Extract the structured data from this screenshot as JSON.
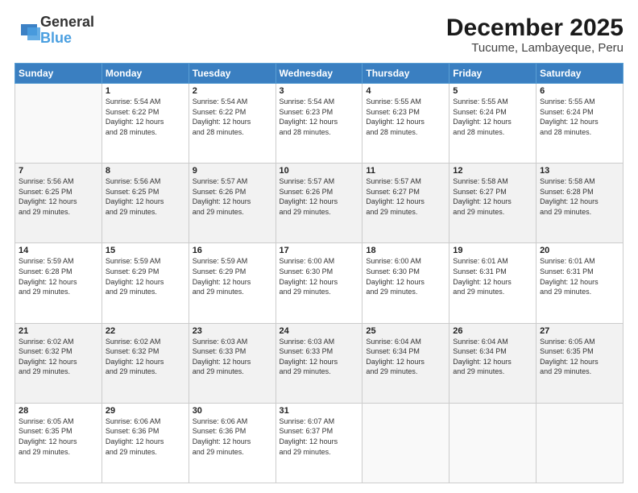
{
  "header": {
    "logo_line1": "General",
    "logo_line2": "Blue",
    "title": "December 2025",
    "subtitle": "Tucume, Lambayeque, Peru"
  },
  "calendar": {
    "days_of_week": [
      "Sunday",
      "Monday",
      "Tuesday",
      "Wednesday",
      "Thursday",
      "Friday",
      "Saturday"
    ],
    "weeks": [
      [
        {
          "num": "",
          "info": ""
        },
        {
          "num": "1",
          "info": "Sunrise: 5:54 AM\nSunset: 6:22 PM\nDaylight: 12 hours\nand 28 minutes."
        },
        {
          "num": "2",
          "info": "Sunrise: 5:54 AM\nSunset: 6:22 PM\nDaylight: 12 hours\nand 28 minutes."
        },
        {
          "num": "3",
          "info": "Sunrise: 5:54 AM\nSunset: 6:23 PM\nDaylight: 12 hours\nand 28 minutes."
        },
        {
          "num": "4",
          "info": "Sunrise: 5:55 AM\nSunset: 6:23 PM\nDaylight: 12 hours\nand 28 minutes."
        },
        {
          "num": "5",
          "info": "Sunrise: 5:55 AM\nSunset: 6:24 PM\nDaylight: 12 hours\nand 28 minutes."
        },
        {
          "num": "6",
          "info": "Sunrise: 5:55 AM\nSunset: 6:24 PM\nDaylight: 12 hours\nand 28 minutes."
        }
      ],
      [
        {
          "num": "7",
          "info": "Sunrise: 5:56 AM\nSunset: 6:25 PM\nDaylight: 12 hours\nand 29 minutes."
        },
        {
          "num": "8",
          "info": "Sunrise: 5:56 AM\nSunset: 6:25 PM\nDaylight: 12 hours\nand 29 minutes."
        },
        {
          "num": "9",
          "info": "Sunrise: 5:57 AM\nSunset: 6:26 PM\nDaylight: 12 hours\nand 29 minutes."
        },
        {
          "num": "10",
          "info": "Sunrise: 5:57 AM\nSunset: 6:26 PM\nDaylight: 12 hours\nand 29 minutes."
        },
        {
          "num": "11",
          "info": "Sunrise: 5:57 AM\nSunset: 6:27 PM\nDaylight: 12 hours\nand 29 minutes."
        },
        {
          "num": "12",
          "info": "Sunrise: 5:58 AM\nSunset: 6:27 PM\nDaylight: 12 hours\nand 29 minutes."
        },
        {
          "num": "13",
          "info": "Sunrise: 5:58 AM\nSunset: 6:28 PM\nDaylight: 12 hours\nand 29 minutes."
        }
      ],
      [
        {
          "num": "14",
          "info": "Sunrise: 5:59 AM\nSunset: 6:28 PM\nDaylight: 12 hours\nand 29 minutes."
        },
        {
          "num": "15",
          "info": "Sunrise: 5:59 AM\nSunset: 6:29 PM\nDaylight: 12 hours\nand 29 minutes."
        },
        {
          "num": "16",
          "info": "Sunrise: 5:59 AM\nSunset: 6:29 PM\nDaylight: 12 hours\nand 29 minutes."
        },
        {
          "num": "17",
          "info": "Sunrise: 6:00 AM\nSunset: 6:30 PM\nDaylight: 12 hours\nand 29 minutes."
        },
        {
          "num": "18",
          "info": "Sunrise: 6:00 AM\nSunset: 6:30 PM\nDaylight: 12 hours\nand 29 minutes."
        },
        {
          "num": "19",
          "info": "Sunrise: 6:01 AM\nSunset: 6:31 PM\nDaylight: 12 hours\nand 29 minutes."
        },
        {
          "num": "20",
          "info": "Sunrise: 6:01 AM\nSunset: 6:31 PM\nDaylight: 12 hours\nand 29 minutes."
        }
      ],
      [
        {
          "num": "21",
          "info": "Sunrise: 6:02 AM\nSunset: 6:32 PM\nDaylight: 12 hours\nand 29 minutes."
        },
        {
          "num": "22",
          "info": "Sunrise: 6:02 AM\nSunset: 6:32 PM\nDaylight: 12 hours\nand 29 minutes."
        },
        {
          "num": "23",
          "info": "Sunrise: 6:03 AM\nSunset: 6:33 PM\nDaylight: 12 hours\nand 29 minutes."
        },
        {
          "num": "24",
          "info": "Sunrise: 6:03 AM\nSunset: 6:33 PM\nDaylight: 12 hours\nand 29 minutes."
        },
        {
          "num": "25",
          "info": "Sunrise: 6:04 AM\nSunset: 6:34 PM\nDaylight: 12 hours\nand 29 minutes."
        },
        {
          "num": "26",
          "info": "Sunrise: 6:04 AM\nSunset: 6:34 PM\nDaylight: 12 hours\nand 29 minutes."
        },
        {
          "num": "27",
          "info": "Sunrise: 6:05 AM\nSunset: 6:35 PM\nDaylight: 12 hours\nand 29 minutes."
        }
      ],
      [
        {
          "num": "28",
          "info": "Sunrise: 6:05 AM\nSunset: 6:35 PM\nDaylight: 12 hours\nand 29 minutes."
        },
        {
          "num": "29",
          "info": "Sunrise: 6:06 AM\nSunset: 6:36 PM\nDaylight: 12 hours\nand 29 minutes."
        },
        {
          "num": "30",
          "info": "Sunrise: 6:06 AM\nSunset: 6:36 PM\nDaylight: 12 hours\nand 29 minutes."
        },
        {
          "num": "31",
          "info": "Sunrise: 6:07 AM\nSunset: 6:37 PM\nDaylight: 12 hours\nand 29 minutes."
        },
        {
          "num": "",
          "info": ""
        },
        {
          "num": "",
          "info": ""
        },
        {
          "num": "",
          "info": ""
        }
      ]
    ]
  }
}
